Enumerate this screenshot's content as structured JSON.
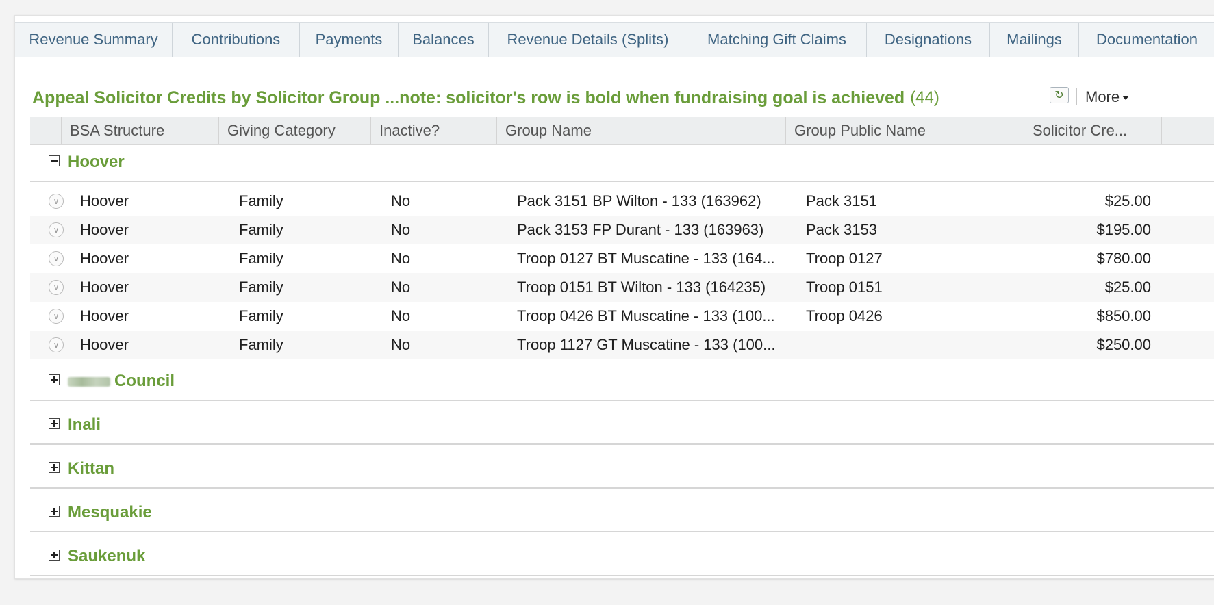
{
  "tabs": [
    {
      "label": "Revenue Summary"
    },
    {
      "label": "Contributions"
    },
    {
      "label": "Payments"
    },
    {
      "label": "Balances"
    },
    {
      "label": "Revenue Details (Splits)"
    },
    {
      "label": "Matching Gift Claims"
    },
    {
      "label": "Designations"
    },
    {
      "label": "Mailings"
    },
    {
      "label": "Documentation"
    }
  ],
  "grid": {
    "title": "Appeal Solicitor Credits by Solicitor Group ...note: solicitor's row is bold when fundraising goal is achieved",
    "count": "(44)",
    "more_label": "More",
    "refresh_icon": "refresh-icon",
    "columns": [
      "BSA Structure",
      "Giving Category",
      "Inactive?",
      "Group Name",
      "Group Public Name",
      "Solicitor Cre..."
    ]
  },
  "groups": [
    {
      "name": "Hoover",
      "expanded": true,
      "rows": [
        {
          "structure": "Hoover",
          "category": "Family",
          "inactive": "No",
          "group_name": "Pack 3151 BP Wilton - 133 (163962)",
          "public_name": "Pack 3151",
          "credit": "$25.00"
        },
        {
          "structure": "Hoover",
          "category": "Family",
          "inactive": "No",
          "group_name": "Pack 3153 FP Durant - 133 (163963)",
          "public_name": "Pack 3153",
          "credit": "$195.00"
        },
        {
          "structure": "Hoover",
          "category": "Family",
          "inactive": "No",
          "group_name": "Troop 0127 BT Muscatine - 133 (164...",
          "public_name": "Troop 0127",
          "credit": "$780.00"
        },
        {
          "structure": "Hoover",
          "category": "Family",
          "inactive": "No",
          "group_name": "Troop 0151 BT Wilton - 133 (164235)",
          "public_name": "Troop 0151",
          "credit": "$25.00"
        },
        {
          "structure": "Hoover",
          "category": "Family",
          "inactive": "No",
          "group_name": "Troop 0426 BT Muscatine - 133 (100...",
          "public_name": "Troop 0426",
          "credit": "$850.00"
        },
        {
          "structure": "Hoover",
          "category": "Family",
          "inactive": "No",
          "group_name": "Troop 1127 GT Muscatine - 133 (100...",
          "public_name": "",
          "credit": "$250.00"
        }
      ]
    },
    {
      "name": "Council",
      "expanded": false,
      "redacted_prefix": true
    },
    {
      "name": "Inali",
      "expanded": false
    },
    {
      "name": "Kittan",
      "expanded": false
    },
    {
      "name": "Mesquakie",
      "expanded": false
    },
    {
      "name": "Saukenuk",
      "expanded": false
    }
  ],
  "colors": {
    "accent_green": "#6a9d3a",
    "tab_text": "#3f6482"
  }
}
